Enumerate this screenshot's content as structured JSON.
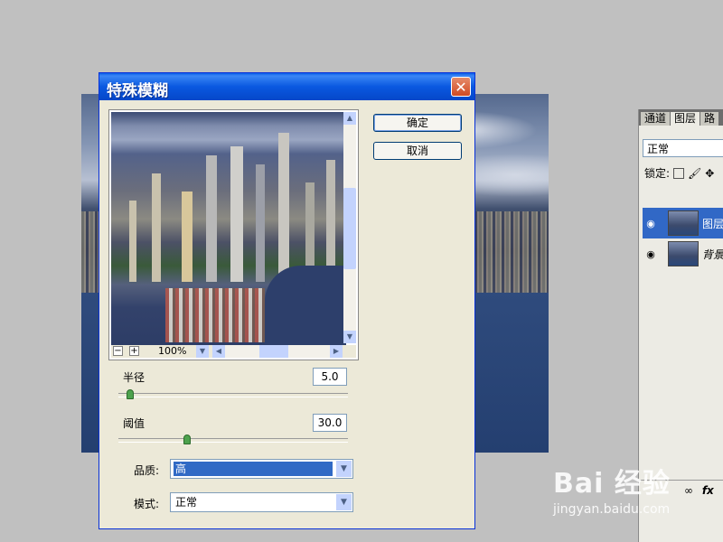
{
  "dialog": {
    "title": "特殊模糊",
    "close_glyph": "✕",
    "ok_label": "确定",
    "cancel_label": "取消",
    "zoom": {
      "minus": "−",
      "plus": "+",
      "level": "100%"
    },
    "radius": {
      "label": "半径",
      "value": "5.0",
      "slider_fraction": 0.05
    },
    "threshold": {
      "label": "阈值",
      "value": "30.0",
      "slider_fraction": 0.3
    },
    "quality": {
      "label": "品质:",
      "value": "高"
    },
    "mode": {
      "label": "模式:",
      "value": "正常"
    }
  },
  "layers_panel": {
    "tabs": [
      "通道",
      "图层",
      "路"
    ],
    "active_tab": 1,
    "blend_mode": "正常",
    "lock_label": "锁定:",
    "layers": [
      {
        "name": "图层",
        "selected": true
      },
      {
        "name": "背景",
        "selected": false
      }
    ],
    "bottom_icons": "fx"
  },
  "watermark": {
    "text": "Bai 经验",
    "url": "jingyan.baidu.com"
  },
  "colors": {
    "title_bar": "#0a58e0",
    "selection": "#316ac5",
    "dialog_bg": "#ece9d8"
  }
}
